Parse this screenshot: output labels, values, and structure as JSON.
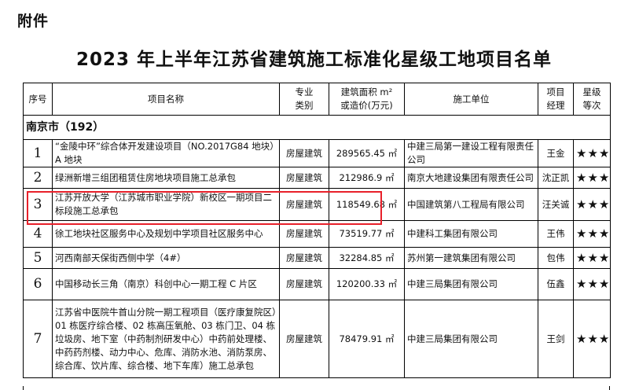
{
  "attachment_label": "附件",
  "title": "2023 年上半年江苏省建筑施工标准化星级工地项目名单",
  "table": {
    "headers": {
      "no": "序号",
      "name": "项目名称",
      "category": "专业\n类别",
      "area": "建筑面积 m²\n或造价(万元)",
      "unit": "施工单位",
      "manager": "项目\n经理",
      "star": "星级\n等次"
    },
    "city": "南京市（192）",
    "rows": [
      {
        "no": "1",
        "name": "“金陵中环”综合体开发建设项目（NO.2017G84 地块）A 地块",
        "category": "房屋建筑",
        "area": "289565.45 ㎡",
        "unit": "中建三局第一建设工程有限责任公司",
        "manager": "王金",
        "star": "★★★"
      },
      {
        "no": "2",
        "name": "绿洲新增三组团租赁住房地块项目施工总承包",
        "category": "房屋建筑",
        "area": "212986.9 ㎡",
        "unit": "南京大地建设集团有限责任公司",
        "manager": "沈正凯",
        "star": "★★★"
      },
      {
        "no": "3",
        "name": "江苏开放大学（江苏城市职业学院）新校区一期项目二标段施工总承包",
        "category": "房屋建筑",
        "area": "118549.68 ㎡",
        "unit": "中国建筑第八工程局有限公司",
        "manager": "汪关诚",
        "star": "★★★"
      },
      {
        "no": "4",
        "name": "徐工地块社区服务中心及规划中学项目社区服务中心",
        "category": "房屋建筑",
        "area": "73519.77 ㎡",
        "unit": "中建科工集团有限公司",
        "manager": "王伟",
        "star": "★★★"
      },
      {
        "no": "5",
        "name": "河西南部天保街西侧中学（4#）",
        "category": "房屋建筑",
        "area": "32284.85 ㎡",
        "unit": "苏州第一建筑集团有限公司",
        "manager": "包伟",
        "star": "★★★"
      },
      {
        "no": "6",
        "name": "中国移动长三角（南京）科创中心一期工程 C 片区",
        "category": "房屋建筑",
        "area": "120200.33 ㎡",
        "unit": "中建三局集团有限公司",
        "manager": "伍鑫",
        "star": "★★★"
      },
      {
        "no": "7",
        "name": "江苏省中医院牛首山分院一期工程项目（医疗康复院区）01 栋医疗综合楼、02 栋高压氧舱、03 栋门卫、04 栋垃圾房、地下室（中药制剂研发中心）中药前处理楼、中药药剂楼、动力中心、危库、消防水池、消防泵房、综合库、饮片库、综合楼、地下车库）施工总承包",
        "category": "房屋建筑",
        "area": "78479.91 ㎡",
        "unit": "中建三局集团有限公司",
        "manager": "王剑",
        "star": "★★★"
      }
    ]
  },
  "highlight_color": "#e8202a"
}
